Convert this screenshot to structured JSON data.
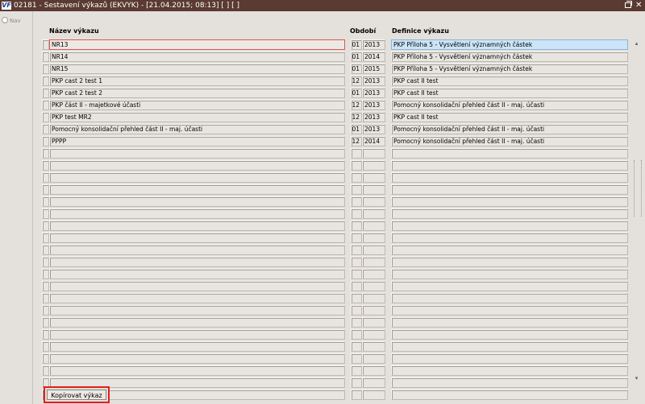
{
  "window": {
    "title": "02181 - Sestavení výkazů (EKVYK) - [21.04.2015; 08:13]  [ ]  [ ]",
    "app_icon": "VF",
    "restore_icon": "restore-icon",
    "close_icon_glyph": "✕"
  },
  "nav": {
    "label": "Nav"
  },
  "columns": {
    "name": "Název výkazu",
    "period": "Období",
    "definition": "Definice výkazu"
  },
  "rows": [
    {
      "name": "NR13",
      "month": "01",
      "year": "2013",
      "definition": "PKP Příloha 5 - Vysvětlení významných částek",
      "active": true
    },
    {
      "name": "NR14",
      "month": "01",
      "year": "2014",
      "definition": "PKP Příloha 5 - Vysvětlení významných částek"
    },
    {
      "name": "NR15",
      "month": "01",
      "year": "2015",
      "definition": "PKP Příloha 5 - Vysvětlení významných částek"
    },
    {
      "name": "PKP cast 2 test 1",
      "month": "12",
      "year": "2013",
      "definition": "PKP cast II test"
    },
    {
      "name": "PKP cast 2 test 2",
      "month": "01",
      "year": "2013",
      "definition": "PKP cast II test"
    },
    {
      "name": "PKP část II - majetkové účasti",
      "month": "12",
      "year": "2013",
      "definition": "Pomocný konsolidační přehled část II - maj. účasti"
    },
    {
      "name": "PKP test MR2",
      "month": "12",
      "year": "2013",
      "definition": "PKP cast II test"
    },
    {
      "name": "Pomocný konsolidační přehled část II - maj. účasti",
      "month": "01",
      "year": "2013",
      "definition": "Pomocný konsolidační přehled část II - maj. účasti"
    },
    {
      "name": "PPPP",
      "month": "12",
      "year": "2014",
      "definition": "Pomocný konsolidační přehled část II - maj. účasti"
    },
    {},
    {},
    {},
    {},
    {},
    {},
    {},
    {},
    {},
    {},
    {},
    {},
    {},
    {},
    {},
    {},
    {},
    {},
    {},
    {},
    {}
  ],
  "copy_button": {
    "label": "Kopírovat výkaz"
  }
}
